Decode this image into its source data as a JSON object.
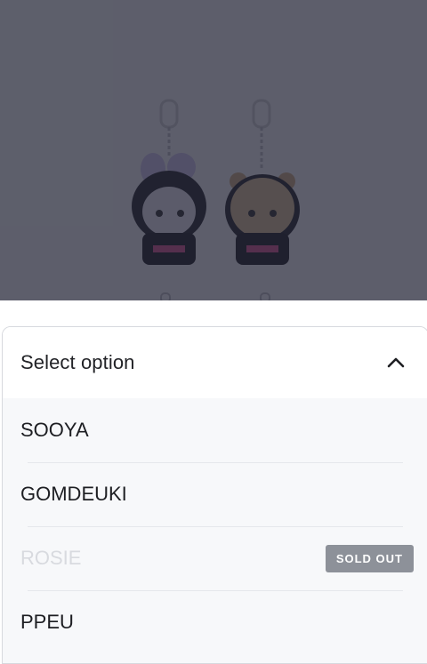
{
  "product": {
    "image_alt_icons": [
      "purple-bunny-keyring-plush",
      "brown-bear-keyring-plush"
    ]
  },
  "option_sheet": {
    "title": "Select option",
    "options": [
      {
        "label": "SOOYA",
        "sold_out": false
      },
      {
        "label": "GOMDEUKI",
        "sold_out": false
      },
      {
        "label": "ROSIE",
        "sold_out": true,
        "badge": "SOLD OUT"
      },
      {
        "label": "PPEU",
        "sold_out": false
      }
    ]
  },
  "colors": {
    "overlay": "#242636",
    "badge_bg": "#8d9199",
    "text": "#1d1e22",
    "disabled_text": "#d8dadf"
  }
}
